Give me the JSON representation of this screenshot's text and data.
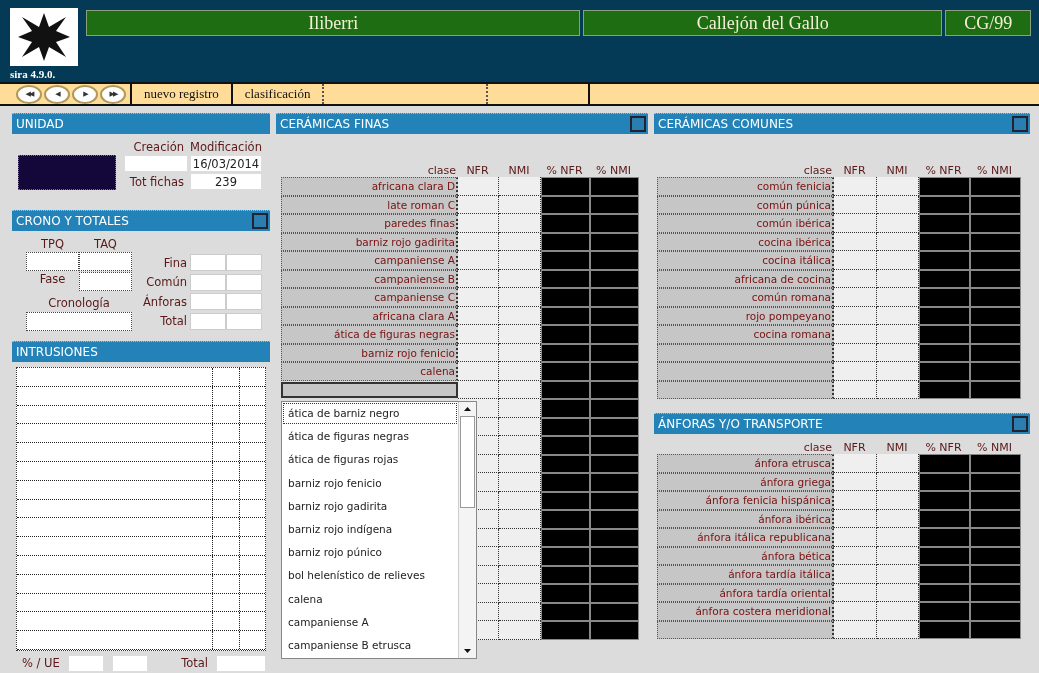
{
  "header": {
    "titles": [
      "Iliberri",
      "Callejón del Gallo",
      "CG/99"
    ],
    "version": "sira 4.9.0."
  },
  "toolbar": {
    "nav_buttons": [
      "◀◀",
      "◀",
      "▶",
      "▶▶"
    ],
    "buttons": [
      "nuevo registro",
      "clasificación"
    ]
  },
  "unidad": {
    "title": "UNIDAD",
    "creacion_label": "Creación",
    "modificacion_label": "Modificación",
    "modificacion": "16/03/2014",
    "tot_fichas_label": "Tot fichas",
    "tot_fichas": "239"
  },
  "crono": {
    "title": "CRONO Y TOTALES",
    "tpq_label": "TPQ",
    "taq_label": "TAQ",
    "fase_label": "Fase",
    "cronologia_label": "Cronología",
    "totals": [
      "Fina",
      "Común",
      "Ánforas",
      "Total"
    ]
  },
  "intrusiones": {
    "title": "INTRUSIONES",
    "footer_label": "% / UE",
    "total_label": "Total"
  },
  "ceramicas_finas": {
    "title": "CERÁMICAS FINAS",
    "columns": [
      "clase",
      "NFR",
      "NMI",
      "% NFR",
      "% NMI"
    ],
    "rows": [
      "africana clara D",
      "late roman C",
      "paredes finas",
      "barniz rojo gadirita",
      "campaniense A",
      "campaniense B",
      "campaniense C",
      "africana clara A",
      "ática de figuras negras",
      "barniz rojo fenicio",
      "calena"
    ],
    "combo": {
      "expanded": true,
      "options": [
        {
          "label": "ática de barniz negro",
          "selected": true
        },
        {
          "label": "ática de figuras negras",
          "selected": false
        },
        {
          "label": "ática de figuras rojas",
          "selected": false
        },
        {
          "label": "barniz rojo fenicio",
          "selected": false
        },
        {
          "label": "barniz rojo gadirita",
          "selected": false
        },
        {
          "label": "barniz rojo indígena",
          "selected": false
        },
        {
          "label": "barniz rojo púnico",
          "selected": false
        },
        {
          "label": "bol helenístico de relieves",
          "selected": false
        },
        {
          "label": "calena",
          "selected": false
        },
        {
          "label": "campaniense A",
          "selected": false
        },
        {
          "label": "campaniense B etrusca",
          "selected": false
        }
      ]
    }
  },
  "ceramicas_comunes": {
    "title": "CERÁMICAS COMUNES",
    "columns": [
      "clase",
      "NFR",
      "NMI",
      "% NFR",
      "% NMI"
    ],
    "rows": [
      "común fenicia",
      "común púnica",
      "común ibérica",
      "cocina ibérica",
      "cocina itálica",
      "africana de cocina",
      "común romana",
      "rojo pompeyano",
      "cocina romana"
    ]
  },
  "anforas": {
    "title": "ÁNFORAS Y/O TRANSPORTE",
    "columns": [
      "clase",
      "NFR",
      "NMI",
      "% NFR",
      "% NMI"
    ],
    "rows": [
      "ánfora etrusca",
      "ánfora griega",
      "ánfora fenicia hispánica",
      "ánfora ibérica",
      "ánfora itálica republicana",
      "ánfora bética",
      "ánfora tardía itálica",
      "ánfora tardía oriental",
      "ánfora costera meridional"
    ]
  }
}
